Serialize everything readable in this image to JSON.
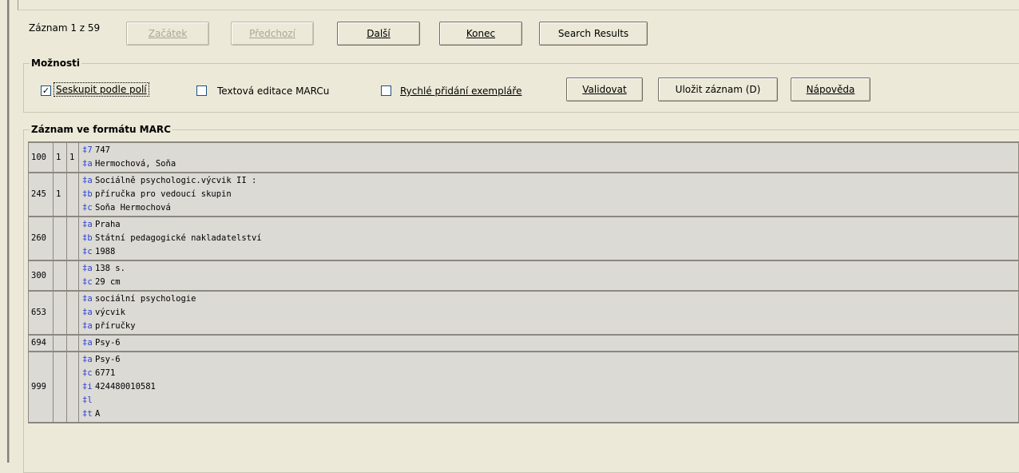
{
  "nav": {
    "record_label": "Záznam 1 z 59",
    "btn_start": "Začátek",
    "btn_prev": "Předchozí",
    "btn_next": "Další",
    "btn_end": "Konec",
    "btn_search_results": "Search Results"
  },
  "options": {
    "legend": "Možnosti",
    "group_by_fields": "Seskupit podle polí",
    "group_by_fields_checked": true,
    "text_edit_marc": "Textová editace MARCu",
    "text_edit_marc_checked": false,
    "quick_add_item": "Rychlé přidání exempláře",
    "quick_add_item_checked": false,
    "btn_validate": "Validovat",
    "btn_save_record": "Uložit záznam (D)",
    "btn_help": "Nápověda"
  },
  "marc": {
    "legend": "Záznam ve formátu MARC",
    "rows": [
      {
        "tag": "100",
        "ind1": "1",
        "ind2": "1",
        "subfields": [
          [
            "‡7",
            "747"
          ],
          [
            "‡a",
            "Hermochová, Soňa"
          ]
        ]
      },
      {
        "tag": "245",
        "ind1": "1",
        "ind2": "",
        "subfields": [
          [
            "‡a",
            "Sociálně psychologic.výcvik II :"
          ],
          [
            "‡b",
            "příručka pro vedoucí skupin"
          ],
          [
            "‡c",
            "Soňa Hermochová"
          ]
        ]
      },
      {
        "tag": "260",
        "ind1": "",
        "ind2": "",
        "subfields": [
          [
            "‡a",
            "Praha"
          ],
          [
            "‡b",
            "Státní pedagogické nakladatelství"
          ],
          [
            "‡c",
            "1988"
          ]
        ]
      },
      {
        "tag": "300",
        "ind1": "",
        "ind2": "",
        "subfields": [
          [
            "‡a",
            "138 s."
          ],
          [
            "‡c",
            "29 cm"
          ]
        ]
      },
      {
        "tag": "653",
        "ind1": "",
        "ind2": "",
        "subfields": [
          [
            "‡a",
            "sociální psychologie"
          ],
          [
            "‡a",
            "výcvik"
          ],
          [
            "‡a",
            "příručky"
          ]
        ]
      },
      {
        "tag": "694",
        "ind1": "",
        "ind2": "",
        "subfields": [
          [
            "‡a",
            "Psy-6"
          ]
        ]
      },
      {
        "tag": "999",
        "ind1": "",
        "ind2": "",
        "subfields": [
          [
            "‡a",
            "Psy-6"
          ],
          [
            "‡c",
            "6771"
          ],
          [
            "‡i",
            "424480010581"
          ],
          [
            "‡l",
            ""
          ],
          [
            "‡t",
            "A"
          ]
        ]
      }
    ]
  }
}
